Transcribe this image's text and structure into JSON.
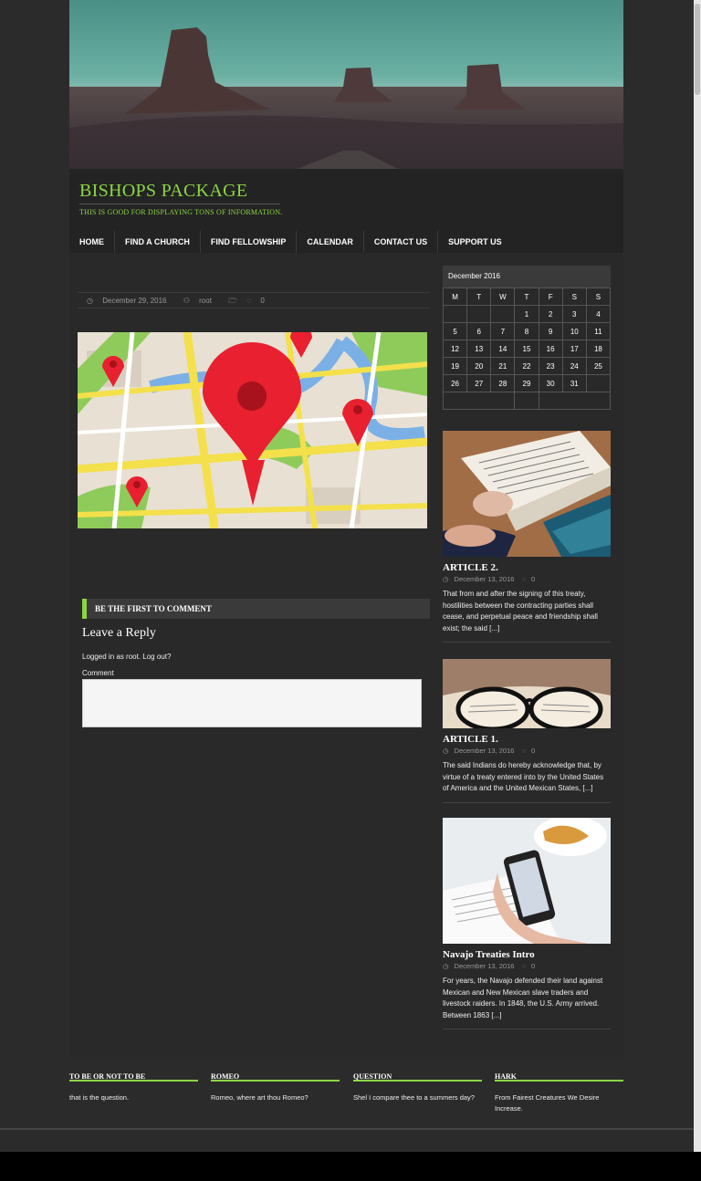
{
  "site": {
    "title": "BISHOPS PACKAGE",
    "tagline": "THIS IS GOOD FOR DISPLAYING TONS OF INFORMATION."
  },
  "nav": [
    "HOME",
    "FIND A CHURCH",
    "FIND FELLOWSHIP",
    "CALENDAR",
    "CONTACT US",
    "SUPPORT US"
  ],
  "post": {
    "date": "December 29, 2016",
    "author": "root",
    "comments": "0"
  },
  "comments": {
    "header": "BE THE FIRST TO COMMENT",
    "reply_heading": "Leave a Reply",
    "logged_in": "Logged in as root. Log out?",
    "comment_label": "Comment"
  },
  "calendar": {
    "caption": "December 2016",
    "days": [
      "M",
      "T",
      "W",
      "T",
      "F",
      "S",
      "S"
    ],
    "rows": [
      [
        "",
        "",
        "",
        "1",
        "2",
        "3",
        "4"
      ],
      [
        "5",
        "6",
        "7",
        "8",
        "9",
        "10",
        "11"
      ],
      [
        "12",
        "13",
        "14",
        "15",
        "16",
        "17",
        "18"
      ],
      [
        "19",
        "20",
        "21",
        "22",
        "23",
        "24",
        "25"
      ],
      [
        "26",
        "27",
        "28",
        "29",
        "30",
        "31",
        ""
      ]
    ]
  },
  "articles": [
    {
      "title": "ARTICLE 2.",
      "date": "December 13, 2016",
      "comments": "0",
      "excerpt": "That from and after the signing of this treaty, hostilities between the contracting parties shall cease, and perpetual peace and friendship shall exist; the said [...]"
    },
    {
      "title": "ARTICLE 1.",
      "date": "December 13, 2016",
      "comments": "0",
      "excerpt": "The said Indians do hereby acknowledge that, by virtue of a treaty entered into by the United States of America and the United Mexican States, [...]"
    },
    {
      "title": "Navajo Treaties Intro",
      "date": "December 13, 2016",
      "comments": "0",
      "excerpt": "For years, the Navajo defended their land against Mexican and New Mexican slave traders and livestock raiders. In 1848, the U.S. Army arrived. Between 1863 [...]"
    }
  ],
  "footer_widgets": [
    {
      "title": "TO BE OR NOT TO BE",
      "text": "that is the question."
    },
    {
      "title": "ROMEO",
      "text": "Romeo, where art thou Romeo?"
    },
    {
      "title": "QUESTION",
      "text": "Shel I compare thee to a summers day?"
    },
    {
      "title": "HARK",
      "text": "From Fairest Creatures We Desire Increase."
    }
  ],
  "colors": {
    "accent": "#8bd544",
    "background": "#2b2b2b",
    "map_pin": "#e8202f"
  }
}
